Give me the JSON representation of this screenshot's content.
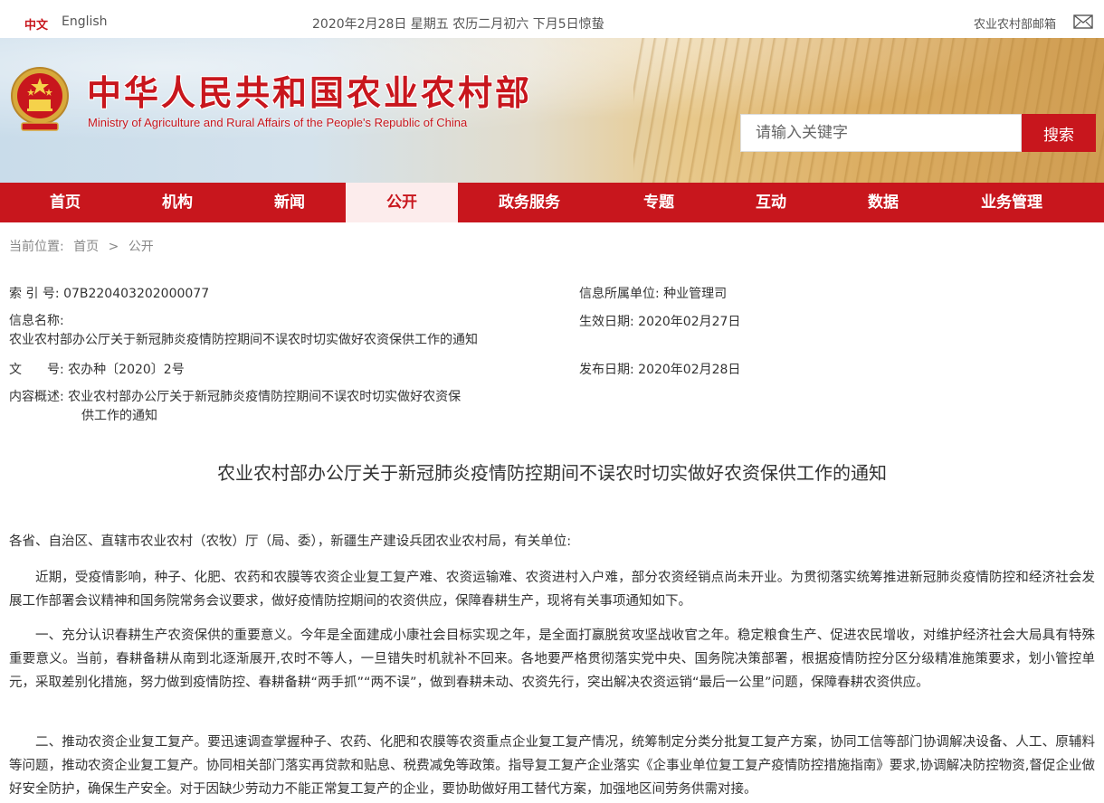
{
  "topbar": {
    "lang_zh": "中文",
    "lang_en": "English",
    "date": "2020年2月28日 星期五 农历二月初六 下月5日惊蛰",
    "mail": "农业农村部邮箱"
  },
  "header": {
    "title": "中华人民共和国农业农村部",
    "subtitle": "Ministry of Agriculture and Rural Affairs of the People's Republic of China",
    "search_placeholder": "请输入关键字",
    "search_button": "搜索"
  },
  "nav": {
    "items": [
      {
        "label": "首页"
      },
      {
        "label": "机构"
      },
      {
        "label": "新闻"
      },
      {
        "label": "公开"
      },
      {
        "label": "政务服务"
      },
      {
        "label": "专题"
      },
      {
        "label": "互动"
      },
      {
        "label": "数据"
      },
      {
        "label": "业务管理"
      }
    ],
    "active": "公开"
  },
  "breadcrumb": {
    "prefix": "当前位置:",
    "home": "首页",
    "sep": ">",
    "current": "公开"
  },
  "meta": {
    "index_label": "索 引 号:",
    "index_value": "07B220403202000077",
    "unit_label": "信息所属单位:",
    "unit_value": "种业管理司",
    "name_label": "信息名称:",
    "name_value": "农业农村部办公厅关于新冠肺炎疫情防控期间不误农时切实做好农资保供工作的通知",
    "effective_label": "生效日期:",
    "effective_value": "2020年02月27日",
    "doc_label": "文　　号:",
    "doc_value": "农办种〔2020〕2号",
    "publish_label": "发布日期:",
    "publish_value": "2020年02月28日",
    "summary_label": "内容概述:",
    "summary_value_1": "农业农村部办公厅关于新冠肺炎疫情防控期间不误农时切实做好农资保",
    "summary_value_2": "供工作的通知"
  },
  "article": {
    "title": "农业农村部办公厅关于新冠肺炎疫情防控期间不误农时切实做好农资保供工作的通知",
    "salutation": "各省、自治区、直辖市农业农村（农牧）厅（局、委），新疆生产建设兵团农业农村局，有关单位:",
    "p1": "近期，受疫情影响，种子、化肥、农药和农膜等农资企业复工复产难、农资运输难、农资进村入户难，部分农资经销点尚未开业。为贯彻落实统筹推进新冠肺炎疫情防控和经济社会发展工作部署会议精神和国务院常务会议要求，做好疫情防控期间的农资供应，保障春耕生产，现将有关事项通知如下。",
    "p2": "一、充分认识春耕生产农资保供的重要意义。今年是全面建成小康社会目标实现之年，是全面打赢脱贫攻坚战收官之年。稳定粮食生产、促进农民增收，对维护经济社会大局具有特殊重要意义。当前，春耕备耕从南到北逐渐展开,农时不等人，一旦错失时机就补不回来。各地要严格贯彻落实党中央、国务院决策部署，根据疫情防控分区分级精准施策要求，划小管控单元，采取差别化措施，努力做到疫情防控、春耕备耕“两手抓”“两不误”，做到春耕未动、农资先行，突出解决农资运销“最后一公里”问题，保障春耕农资供应。",
    "p3": "二、推动农资企业复工复产。要迅速调查掌握种子、农药、化肥和农膜等农资重点企业复工复产情况，统筹制定分类分批复工复产方案，协同工信等部门协调解决设备、人工、原辅料等问题，推动农资企业复工复产。协同相关部门落实再贷款和贴息、税费减免等政策。指导复工复产企业落实《企事业单位复工复产疫情防控措施指南》要求,协调解决防控物资,督促企业做好安全防护，确保生产安全。对于因缺少劳动力不能正常复工复产的企业，要协助做好用工替代方案，加强地区间劳务供需对接。"
  },
  "colors": {
    "brand_red": "#c8161d",
    "active_tab_bg": "#fcecec"
  }
}
